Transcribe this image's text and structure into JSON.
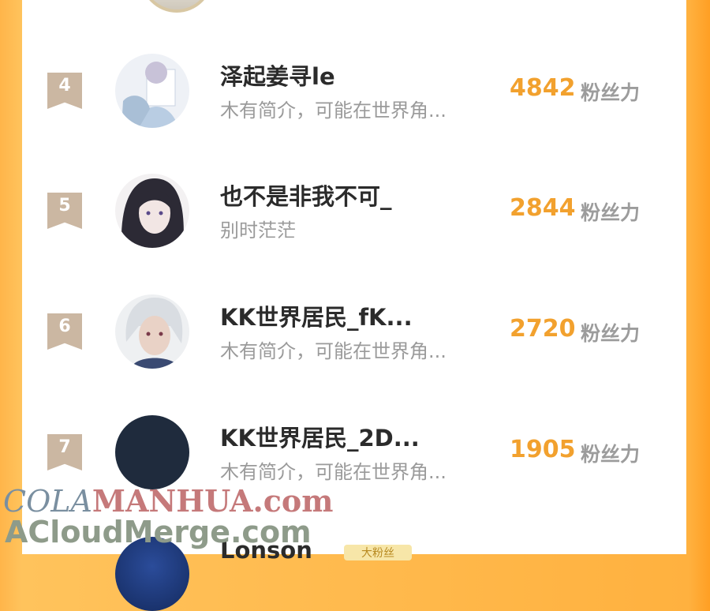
{
  "rows": [
    {
      "rank": "4",
      "name": "泽起姜寻le",
      "bio": "木有简介，可能在世界角...",
      "score": "4842",
      "unit": "粉丝力"
    },
    {
      "rank": "5",
      "name": "也不是非我不可_",
      "bio": "别时茫茫",
      "score": "2844",
      "unit": "粉丝力"
    },
    {
      "rank": "6",
      "name": "KK世界居民_fK...",
      "bio": "木有简介，可能在世界角...",
      "score": "2720",
      "unit": "粉丝力"
    },
    {
      "rank": "7",
      "name": "KK世界居民_2D...",
      "bio": "木有简介，可能在世界角...",
      "score": "1905",
      "unit": "粉丝力"
    }
  ],
  "watermark": {
    "line1_a": "COLA",
    "line1_b": "MANHUA.com",
    "line2": "ACloudMerge.com"
  },
  "partial": {
    "name": "Lonson",
    "badge": "大粉丝"
  },
  "colors": {
    "accent": "#f2a12e",
    "rank_bg": "#cbb7a2",
    "frame": "#ffb13f"
  }
}
